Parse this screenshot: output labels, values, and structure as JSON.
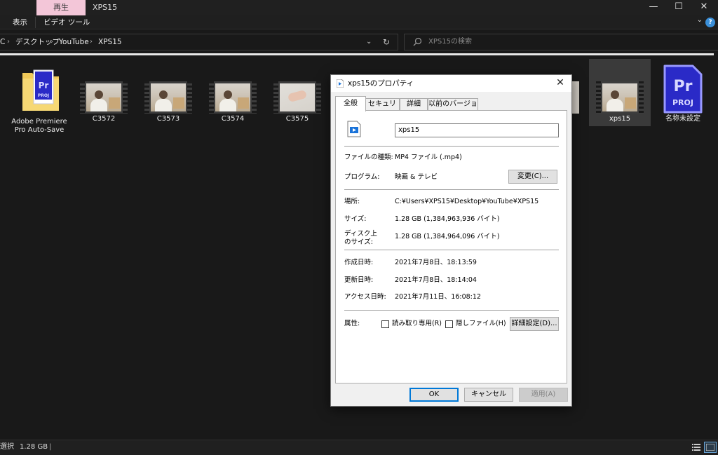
{
  "window": {
    "active_tab": "再生",
    "title": "XPS15",
    "controls": {
      "minimize": "—",
      "maximize": "☐",
      "close": "✕"
    }
  },
  "ribbon": {
    "tabs": [
      "表示",
      "ビデオ ツール"
    ],
    "expand": "⌄",
    "help": "?"
  },
  "address": {
    "root_fragment": "C",
    "crumbs": [
      "デスクトップ",
      "YouTube",
      "XPS15"
    ],
    "separator": "›",
    "dropdown": "⌄",
    "refresh": "↻"
  },
  "search": {
    "placeholder": "XPS15の検索"
  },
  "files": [
    {
      "label": "Adobe Premiere Pro Auto-Save",
      "label_lines": [
        "Adobe Premiere",
        "Pro Auto-Save"
      ],
      "type": "folder"
    },
    {
      "label": "C3572",
      "type": "video"
    },
    {
      "label": "C3573",
      "type": "video"
    },
    {
      "label": "C3574",
      "type": "video"
    },
    {
      "label": "C3575",
      "type": "video"
    },
    {
      "label": "xps15",
      "type": "video",
      "selected": true
    },
    {
      "label": "名称未設定",
      "type": "premiere-project"
    }
  ],
  "premiere": {
    "pr": "Pr",
    "proj": "PROJ"
  },
  "status": {
    "selection": "選択",
    "size": "1.28 GB",
    "separator": "|"
  },
  "dialog": {
    "title": "xps15のプロパティ",
    "close": "✕",
    "tabs": [
      "全般",
      "セキュリティ",
      "詳細",
      "以前のバージョン"
    ],
    "file_name": "xps15",
    "rows": {
      "type_label": "ファイルの種類:",
      "type_value": "MP4 ファイル (.mp4)",
      "program_label": "プログラム:",
      "program_value": "映画 & テレビ",
      "change_button": "変更(C)...",
      "location_label": "場所:",
      "location_value": "C:¥Users¥XPS15¥Desktop¥YouTube¥XPS15",
      "size_label": "サイズ:",
      "size_value": "1.28 GB (1,384,963,936 バイト)",
      "disk_size_label_1": "ディスク上",
      "disk_size_label_2": "のサイズ:",
      "disk_size_value": "1.28 GB (1,384,964,096 バイト)",
      "created_label": "作成日時:",
      "created_value": "2021年7月8日、18:13:59",
      "modified_label": "更新日時:",
      "modified_value": "2021年7月8日、18:14:04",
      "accessed_label": "アクセス日時:",
      "accessed_value": "2021年7月11日、16:08:12",
      "attributes_label": "属性:",
      "readonly_label": "読み取り専用(R)",
      "readonly_checked": false,
      "hidden_label": "隠しファイル(H)",
      "hidden_checked": false,
      "advanced_button": "詳細設定(D)..."
    },
    "buttons": {
      "ok": "OK",
      "cancel": "キャンセル",
      "apply": "適用(A)"
    }
  },
  "colors": {
    "explorer_bg": "#191919",
    "active_tab": "#f3c6d8",
    "premiere_blue": "#2a2ac7",
    "accent": "#0078d7"
  }
}
